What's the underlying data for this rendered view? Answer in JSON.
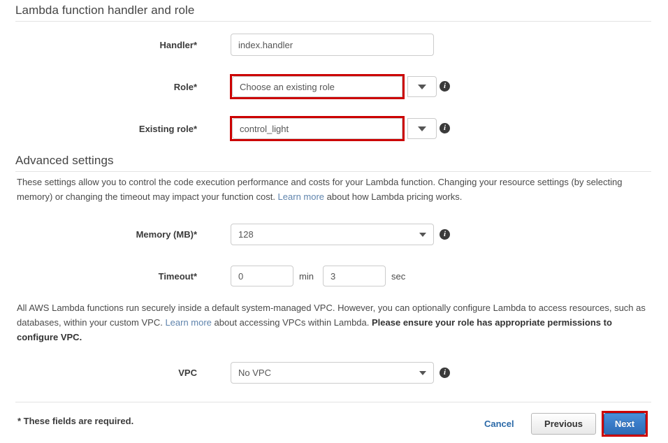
{
  "handler_section": {
    "title": "Lambda function handler and role",
    "handler": {
      "label": "Handler",
      "required_mark": "*",
      "value": "index.handler"
    },
    "role": {
      "label": "Role",
      "required_mark": "*",
      "value": "Choose an existing role",
      "info_icon": "info-icon",
      "arrow_icon": "chevron-down-icon",
      "highlight_color": "#cc0000"
    },
    "existing_role": {
      "label": "Existing role",
      "required_mark": "*",
      "value": "control_light",
      "info_icon": "info-icon",
      "arrow_icon": "chevron-down-icon",
      "highlight_color": "#cc0000"
    }
  },
  "advanced_section": {
    "title": "Advanced settings",
    "description": {
      "part1": "These settings allow you to control the code execution performance and costs for your Lambda function. Changing your resource settings (by selecting memory) or changing the timeout may impact your function cost. ",
      "link": "Learn more",
      "part2": " about how Lambda pricing works."
    },
    "memory": {
      "label": "Memory (MB)",
      "required_mark": "*",
      "value": "128",
      "info_icon": "info-icon",
      "arrow_icon": "chevron-down-icon"
    },
    "timeout": {
      "label": "Timeout",
      "required_mark": "*",
      "minutes_value": "0",
      "minutes_unit": "min",
      "seconds_value": "3",
      "seconds_unit": "sec"
    },
    "vpc_description": {
      "part1": "All AWS Lambda functions run securely inside a default system-managed VPC. However, you can optionally configure Lambda to access resources, such as databases, within your custom VPC. ",
      "link": "Learn more",
      "part2": " about accessing VPCs within Lambda. ",
      "bold": "Please ensure your role has appropriate permissions to configure VPC."
    },
    "vpc": {
      "label": "VPC",
      "value": "No VPC",
      "info_icon": "info-icon",
      "arrow_icon": "chevron-down-icon"
    }
  },
  "footer": {
    "required_note": "* These fields are required.",
    "cancel_label": "Cancel",
    "previous_label": "Previous",
    "next_label": "Next",
    "next_highlight_color": "#cc0000"
  }
}
